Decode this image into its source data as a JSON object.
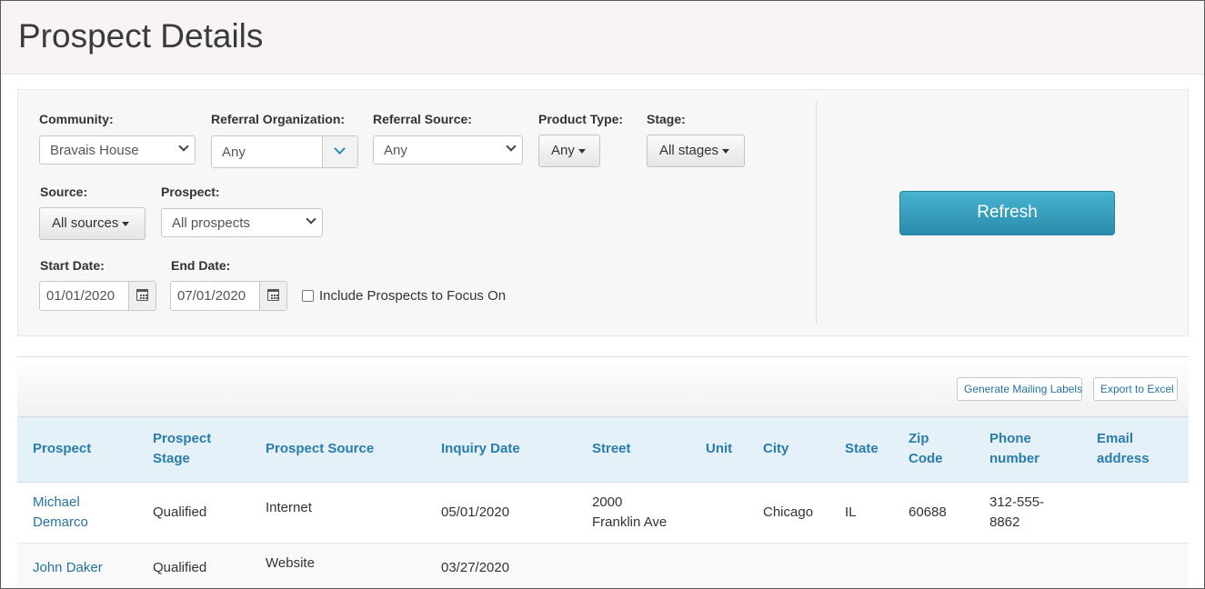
{
  "page": {
    "title": "Prospect Details"
  },
  "filters": {
    "community": {
      "label": "Community:",
      "value": "Bravais House"
    },
    "referral_organization": {
      "label": "Referral Organization:",
      "value": "Any"
    },
    "referral_source": {
      "label": "Referral Source:",
      "value": "Any"
    },
    "product_type": {
      "label": "Product Type:",
      "value": "Any"
    },
    "stage": {
      "label": "Stage:",
      "value": "All stages"
    },
    "source": {
      "label": "Source:",
      "value": "All sources"
    },
    "prospect": {
      "label": "Prospect:",
      "value": "All prospects"
    },
    "start_date": {
      "label": "Start Date:",
      "value": "01/01/2020"
    },
    "end_date": {
      "label": "End Date:",
      "value": "07/01/2020"
    },
    "include_focus": {
      "label": "Include Prospects to Focus On",
      "checked": false
    },
    "refresh_label": "Refresh"
  },
  "toolbar": {
    "mailing_labels": "Generate Mailing Labels",
    "export_excel": "Export to Excel"
  },
  "table": {
    "headers": {
      "prospect": "Prospect",
      "stage_line1": "Prospect",
      "stage_line2": "Stage",
      "source": "Prospect Source",
      "inquiry_date": "Inquiry Date",
      "street": "Street",
      "unit": "Unit",
      "city": "City",
      "state": "State",
      "zip_line1": "Zip",
      "zip_line2": "Code",
      "phone_line1": "Phone",
      "phone_line2": "number",
      "email_line1": "Email",
      "email_line2": "address"
    },
    "rows": [
      {
        "prospect_line1": "Michael",
        "prospect_line2": "Demarco",
        "stage": "Qualified",
        "source": "Internet",
        "inquiry_date": "05/01/2020",
        "street_line1": "2000",
        "street_line2": "Franklin Ave",
        "unit": "",
        "city": "Chicago",
        "state": "IL",
        "zip": "60688",
        "phone_line1": "312-555-",
        "phone_line2": "8862",
        "email": ""
      },
      {
        "prospect": "John Daker",
        "stage": "Qualified",
        "source": "Website",
        "inquiry_date": "03/27/2020",
        "street": "",
        "unit": "",
        "city": "",
        "state": "",
        "zip": "",
        "phone": "",
        "email": ""
      }
    ]
  },
  "colors": {
    "link": "#2673a0",
    "header_text": "#2a7cab",
    "refresh_button": "#3aa3c2",
    "table_header_bg": "#e5f1f9"
  }
}
